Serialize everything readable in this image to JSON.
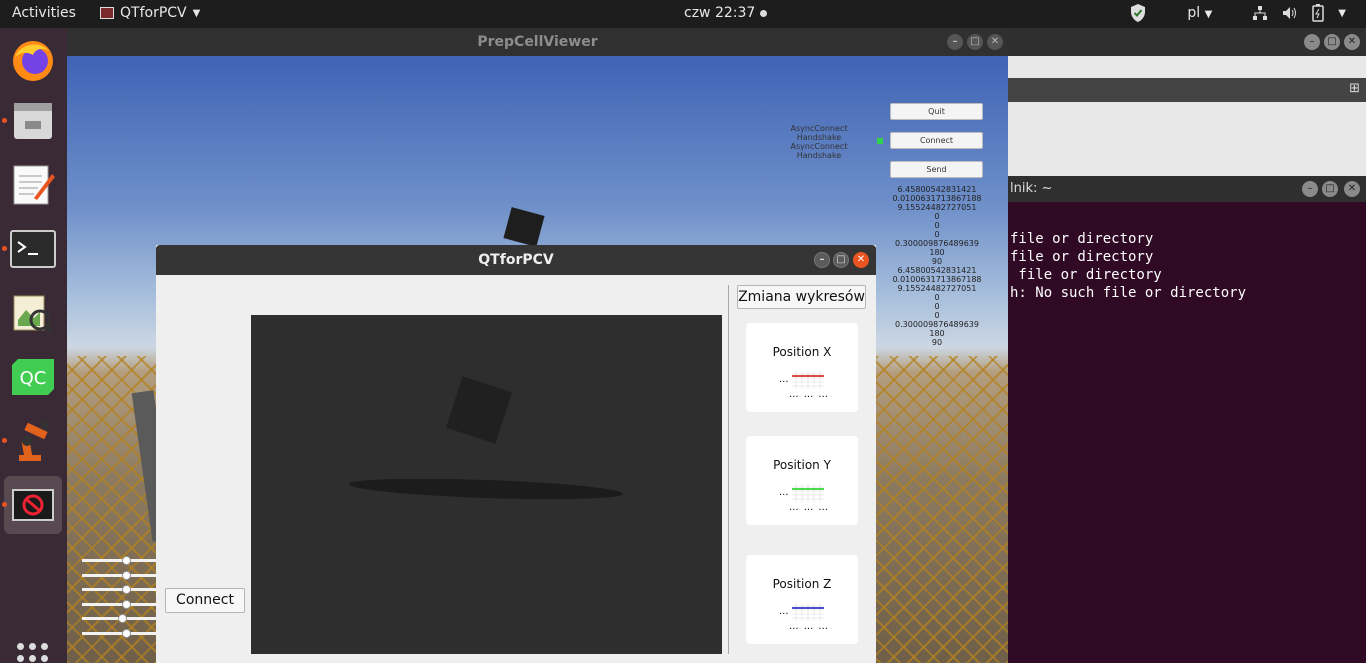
{
  "topbar": {
    "activities": "Activities",
    "app_name": "QTforPCV",
    "clock": "czw 22:37",
    "lang": "pl"
  },
  "dock": {
    "items": [
      "firefox-icon",
      "files-icon",
      "text-editor-icon",
      "terminal-icon",
      "image-viewer-icon",
      "qtcreator-icon",
      "robot-icon",
      "unity-app-icon"
    ],
    "qt_label": "QC"
  },
  "prepcell": {
    "title": "PrepCellViewer",
    "buttons": {
      "quit": "Quit",
      "connect": "Connect",
      "send": "Send"
    },
    "log": [
      "AsyncConnect",
      "Handshake",
      "AsyncConnect",
      "Handshake"
    ],
    "values": [
      "6.45800542831421",
      "0.0100631713867188",
      "9.15524482727051",
      "0",
      "0",
      "0",
      "0.300009876489639",
      "180",
      "90",
      "6.45800542831421",
      "0.0100631713867188",
      "9.15524482727051",
      "0",
      "0",
      "0",
      "0.300009876489639",
      "180",
      "90"
    ],
    "sliders": [
      0.56,
      0.56,
      0.56,
      0.56,
      0.5,
      0.56
    ]
  },
  "terminal": {
    "title": "lnik: ~",
    "lines": [
      "file or directory",
      "file or directory",
      " file or directory",
      "h: No such file or directory"
    ]
  },
  "qt": {
    "title": "QTforPCV",
    "connect": "Connect",
    "switch_charts": "Zmiana wykresów",
    "cards": [
      {
        "title": "Position X",
        "color": "#d01010",
        "dots_left": "...",
        "dots_bottom": "... ... ..."
      },
      {
        "title": "Position Y",
        "color": "#10d010",
        "dots_left": "...",
        "dots_bottom": "... ... ..."
      },
      {
        "title": "Position Z",
        "color": "#1010c0",
        "dots_left": "...",
        "dots_bottom": "... ... ..."
      }
    ]
  }
}
